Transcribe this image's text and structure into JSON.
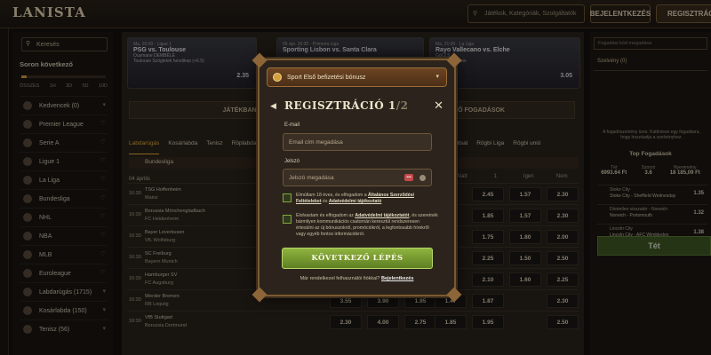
{
  "header": {
    "logo": "LANISTA",
    "search_placeholder": "Játékok, Kategóriák, Szolgáltatók",
    "login_label": "BEJELENTKEZÉS",
    "register_label": "REGISZTRÁCIÓ"
  },
  "sidebar": {
    "search_placeholder": "Keresés",
    "title": "Soron következő",
    "timeline": [
      "ÖSSZES",
      "1H",
      "3D",
      "5D",
      "10D"
    ],
    "timeline_value": 0.06,
    "items": [
      {
        "label": "Kedvencek (0)"
      },
      {
        "label": "Premier League"
      },
      {
        "label": "Serie A"
      },
      {
        "label": "Ligue 1"
      },
      {
        "label": "La Liga"
      },
      {
        "label": "Bundesliga"
      },
      {
        "label": "NHL"
      },
      {
        "label": "NBA"
      },
      {
        "label": "MLB"
      },
      {
        "label": "Euroleague"
      },
      {
        "label": "Labdarúgás (1715)"
      },
      {
        "label": "Kosárlabda (150)"
      },
      {
        "label": "Tenisz (56)"
      }
    ]
  },
  "cards": [
    {
      "meta": "Ma, 20:00 · Ligue 1",
      "team": "PSG vs. Toulouse",
      "sub1": "Ousmane DEMBÉLÉ",
      "sub2": "Toulouse Szögletek hendikep (+6.5)",
      "odd": "2.35"
    },
    {
      "meta": "05 ápr. 20:30 · Primeira Liga",
      "team": "Sporting Lisbon vs. Santa Clara",
      "sub1": "",
      "sub2": "",
      "odd": ""
    },
    {
      "meta": "Ma, 21:00 · La Liga",
      "team": "Rayo Vallecano vs. Elche",
      "sub1": "Gól 2.5",
      "sub2": "Rayo Vallecano",
      "odd": "3.05"
    }
  ],
  "main": {
    "tab_live": "JÁTÉKBAN",
    "tab_upcoming": "KÖVETKEZŐ FOGADÁSOK",
    "sports": [
      "Labdarúgás",
      "Kosárlabda",
      "Tenisz",
      "Röplabda",
      "Jégkorong",
      "Amerikai foci",
      "Kézilabda",
      "Sakk",
      "Dart",
      "Snooker",
      "Futsal",
      "Rögbi Liga",
      "Rögbi unió"
    ],
    "league": "Bundesliga",
    "date": "04 április",
    "headers": [
      "Alatt",
      "1",
      "Igen",
      "Nem"
    ],
    "rows": [
      {
        "time": "16:30",
        "t1": "TSG Hoffenheim",
        "t2": "Mainz",
        "o": [
          "2.45",
          "1.57",
          "2.30"
        ]
      },
      {
        "time": "16:30",
        "t1": "Borussia Mönchengladbach",
        "t2": "FC Heidenheim",
        "o": [
          "1.85",
          "1.57",
          "2.30"
        ]
      },
      {
        "time": "16:30",
        "t1": "Bayer Leverkusen",
        "t2": "VfL Wolfsburg",
        "o": [
          "1.75",
          "1.80",
          "2.00"
        ]
      },
      {
        "time": "16:30",
        "t1": "SC Freiburg",
        "t2": "Bayern Munich",
        "o": [
          "2.25",
          "1.50",
          "2.50"
        ]
      },
      {
        "time": "16:30",
        "t1": "Hamburger SV",
        "t2": "FC Augsburg",
        "o": [
          "2.10",
          "1.60",
          "2.25"
        ]
      },
      {
        "time": "16:30",
        "t1": "Werder Bremen",
        "t2": "RB Leipzig",
        "o": [
          "3.55",
          "3.90",
          "1.95",
          "1.47",
          "1.87",
          "2.30"
        ]
      },
      {
        "time": "18:30",
        "t1": "VfB Stuttgart",
        "t2": "Borussia Dortmund",
        "o": [
          "2.30",
          "4.00",
          "2.75",
          "1.85",
          "1.95",
          "2.50"
        ]
      }
    ]
  },
  "right": {
    "input_placeholder": "Fogadási kód megadása",
    "tab": "Szelvény (0)",
    "note": "A fogadószelvény üres. Kattintson egy fogadásra, hogy hozzáadja a szelvényhez.",
    "top_title": "Top Fogadások",
    "stats": [
      {
        "label": "Tét",
        "value": "6993.64 Ft"
      },
      {
        "label": "Szorzó",
        "value": "3.6"
      },
      {
        "label": "Nyeremény",
        "value": "18 185,09 Ft"
      }
    ],
    "bets": [
      {
        "l1": "Stoke City",
        "l2": "Stoke City - Sheffield Wednesday",
        "odd": "1.35"
      },
      {
        "l1": "Döntetlen visszatér - Norwich",
        "l2": "Norwich - Portsmouth",
        "odd": "1.32"
      },
      {
        "l1": "Lincoln City",
        "l2": "Lincoln City - AFC Wimbledon",
        "odd": "1.38"
      }
    ],
    "bet_button": "Tét"
  },
  "modal": {
    "bonus": "Sport Első befizetési bónusz",
    "title": "REGISZTRÁCIÓ 1",
    "title_of": "/2",
    "email_label": "E-mail",
    "email_placeholder": "Email cím megadása",
    "pw_label": "Jelszó",
    "pw_placeholder": "Jelszó megadása",
    "check1_a": "Elmúltam 18 éves, és elfogadom a ",
    "check1_link": "Általános Szerződési Feltételeket",
    "check1_b": " és ",
    "check1_link2": "Adatvédelmi tájékoztató",
    "check2_a": "Elolvastam és elfogadom az ",
    "check2_link": "Adatvédelmi tájékoztatót",
    "check2_b": ", és szeretnék bármilyen kommunikációs csatornán keresztül rendszeresen értesülni az új bónuszokról, promóciókról, a legfontosabb hírekről vagy egyéb fontos információkról.",
    "next_button": "KÖVETKEZŐ LÉPÉS",
    "has_account": "Már rendelkezel felhasználói fiókkal? ",
    "login_link": "Bejelentkezés"
  }
}
